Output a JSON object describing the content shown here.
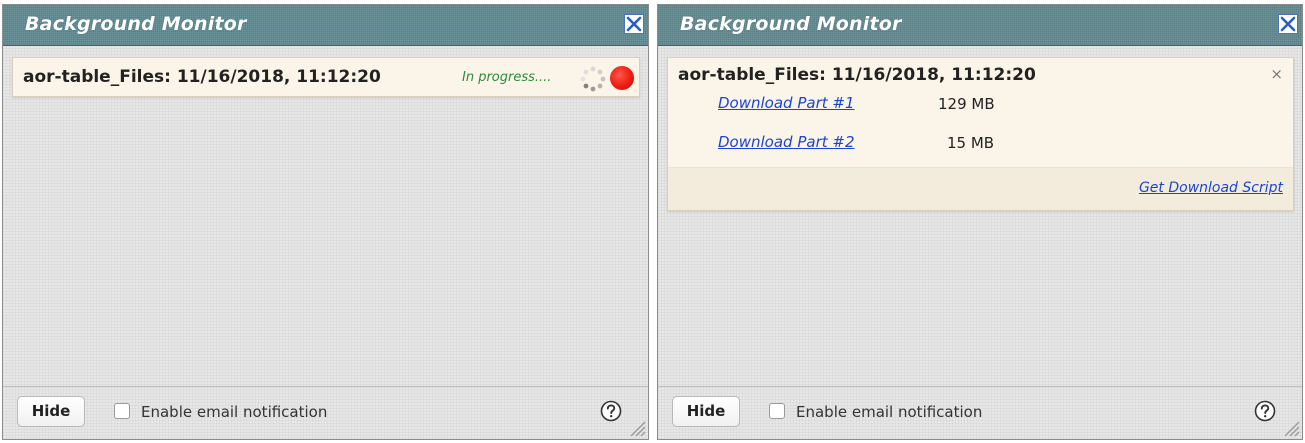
{
  "left_panel": {
    "title": "Background Monitor",
    "job": {
      "title": "aor-table_Files: 11/16/2018, 11:12:20",
      "status": "In progress...."
    },
    "footer": {
      "hide_label": "Hide",
      "email_label": "Enable email notification"
    }
  },
  "right_panel": {
    "title": "Background Monitor",
    "job": {
      "title": "aor-table_Files: 11/16/2018, 11:12:20",
      "remove_symbol": "×",
      "parts": [
        {
          "label": "Download Part #1",
          "size": "129 MB"
        },
        {
          "label": "Download Part #2",
          "size": "15 MB"
        }
      ],
      "script_link": "Get Download Script"
    },
    "footer": {
      "hide_label": "Hide",
      "email_label": "Enable email notification"
    }
  },
  "colors": {
    "titlebar": "#5f8b92",
    "link": "#1a44d6",
    "status_green": "#2f8a3a",
    "stop_red": "#ee1b10",
    "card_bg": "#fbf5e9"
  },
  "icons": {
    "close": "close-icon",
    "spinner": "spinner-icon",
    "stop": "stop-icon",
    "help": "help-icon",
    "resize": "resize-grip-icon"
  }
}
